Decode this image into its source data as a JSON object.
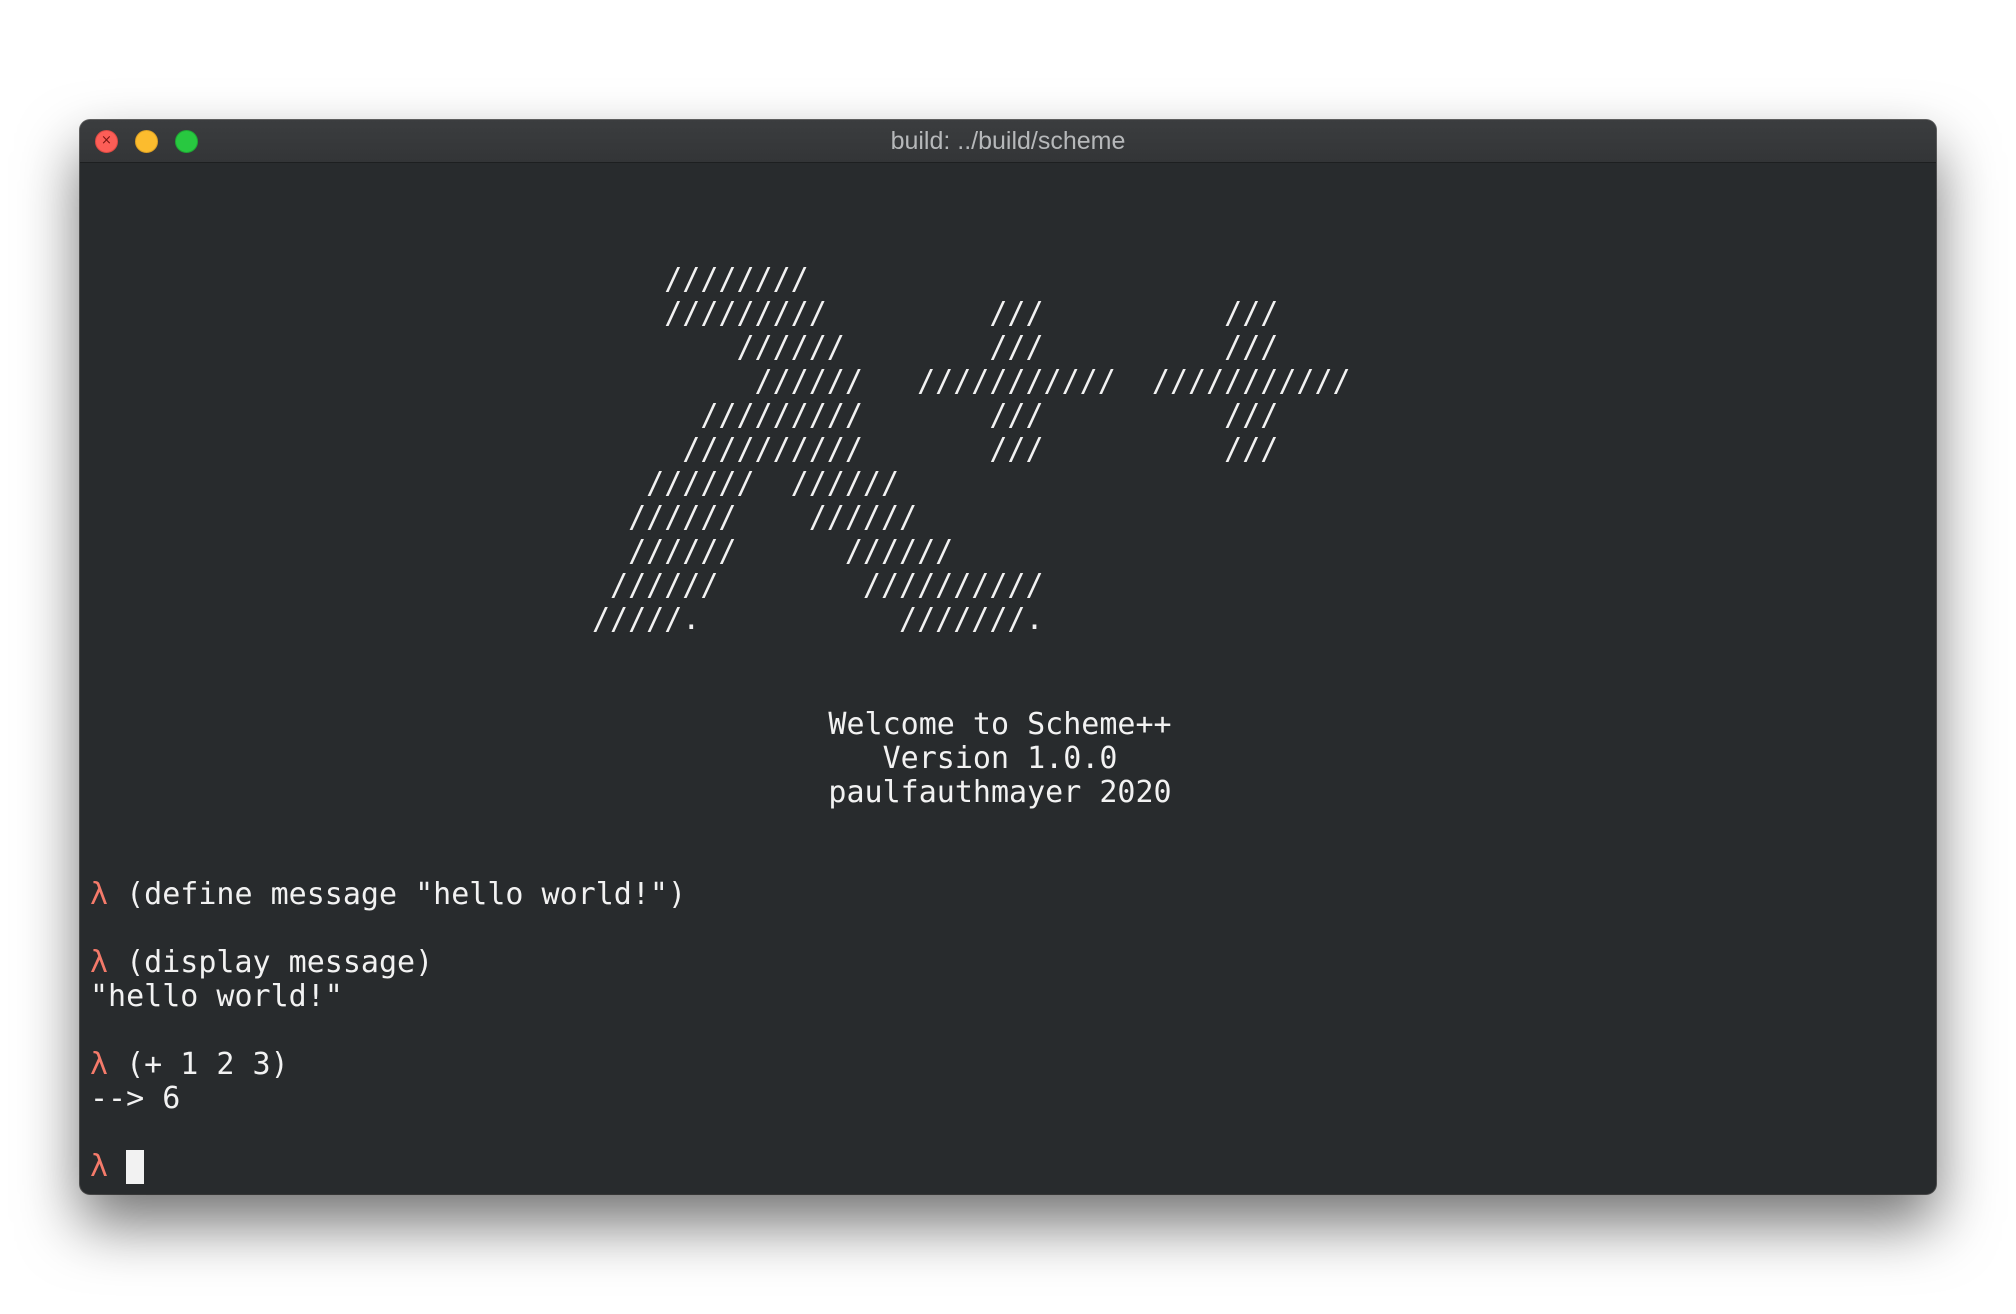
{
  "window": {
    "title": "build: ../build/scheme",
    "close_glyph": "×"
  },
  "banner": {
    "ascii_art": "    ////////\n    /////////         ///          ///\n        //////        ///          ///\n         //////   ///////////  ///////////\n      /////////       ///          ///\n     //////////       ///          ///\n   //////  //////\n  //////    //////\n  //////      //////\n //////        //////////\n/////.           ///////.",
    "welcome": "Welcome to Scheme++",
    "version": "Version 1.0.0",
    "author": "paulfauthmayer 2020"
  },
  "session": {
    "prompt_symbol": "λ",
    "entries": [
      {
        "input": "(define message \"hello world!\")"
      },
      {
        "input": "(display message)",
        "output": "\"hello world!\""
      },
      {
        "input": "(+ 1 2 3)",
        "output": "--> 6"
      }
    ]
  }
}
